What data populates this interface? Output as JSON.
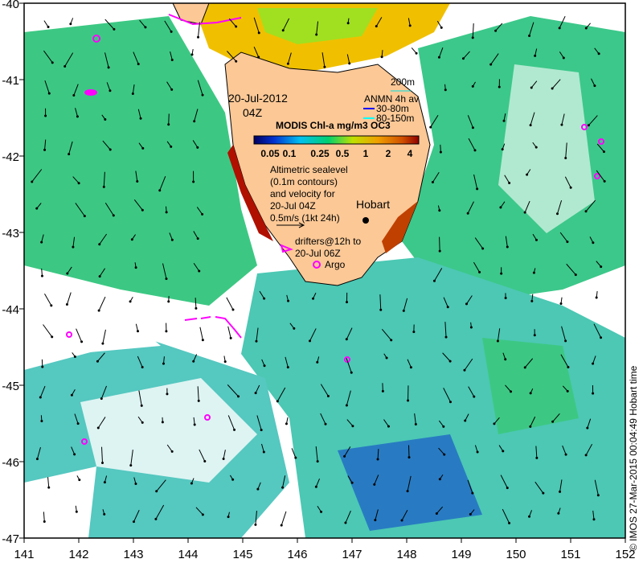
{
  "map": {
    "lon_ticks": [
      "141",
      "142",
      "143",
      "144",
      "145",
      "146",
      "147",
      "148",
      "149",
      "150",
      "151",
      "152"
    ],
    "lat_ticks": [
      "-40",
      "-41",
      "-42",
      "-43",
      "-44",
      "-45",
      "-46",
      "-47"
    ],
    "lon_range": [
      141,
      152
    ],
    "lat_range": [
      -47,
      -40
    ],
    "land_color": "#fbc896",
    "ocean_nodata_color": "#ffffff"
  },
  "annotations": {
    "date": "20-Jul-2012",
    "time": "04Z",
    "depth_scale": "200m",
    "anmn_title": "ANMN 4h av",
    "anmn_shallow": "30-80m",
    "anmn_deep": "80-150m",
    "anmn_shallow_color": "#0000ff",
    "anmn_deep_color": "#00ffff",
    "colorbar_title": "MODIS Chl-a mg/m3 OC3",
    "colorbar_labels": [
      "0.05",
      "0.1",
      "0.25",
      "0.5",
      "1",
      "2",
      "4"
    ],
    "altimetry_lines": [
      "Altimetric sealevel",
      "(0.1m contours)",
      "and velocity for",
      "20-Jul 04Z",
      "0.5m/s (1kt 24h)"
    ],
    "drifters_lines": [
      "drifters@12h to",
      "20-Jul 06Z"
    ],
    "argo_label": "Argo",
    "city_label": "Hobart",
    "credit": "© IMOS 27-Mar-2015 00:04:49 Hobart time",
    "drifter_color": "#ff00ff",
    "argo_color": "#ff00ff"
  }
}
